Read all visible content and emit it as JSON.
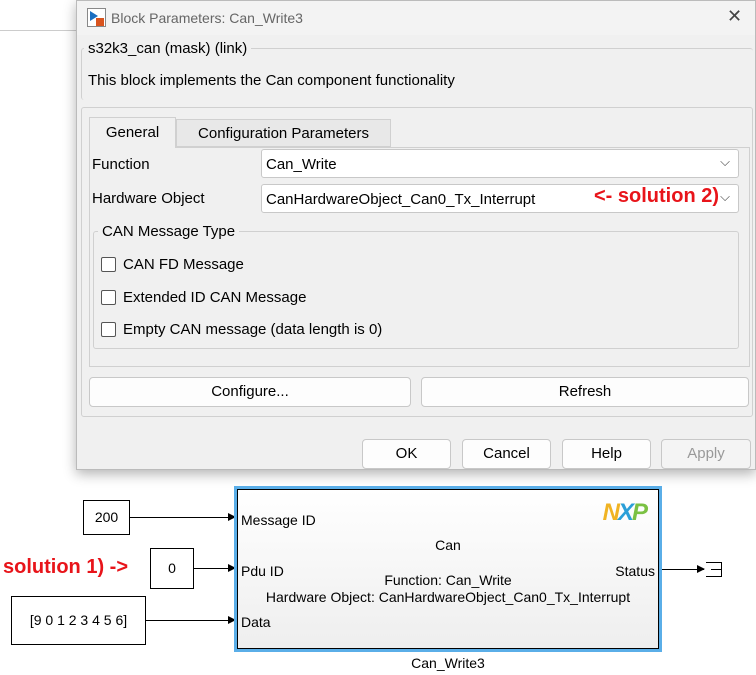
{
  "dialog": {
    "title": "Block Parameters: Can_Write3",
    "mask_title": "s32k3_can (mask) (link)",
    "description": "This block implements the Can component functionality",
    "tabs": [
      {
        "label": "General"
      },
      {
        "label": "Configuration Parameters"
      }
    ],
    "function_label": "Function",
    "function_value": "Can_Write",
    "hw_label": "Hardware Object",
    "hw_value": "CanHardwareObject_Can0_Tx_Interrupt",
    "msg_type_group": "CAN Message Type",
    "checkboxes": [
      {
        "label": "CAN FD Message",
        "checked": false
      },
      {
        "label": "Extended ID CAN Message",
        "checked": false
      },
      {
        "label": "Empty CAN message (data length is 0)",
        "checked": false
      }
    ],
    "configure_label": "Configure...",
    "refresh_label": "Refresh",
    "ok_label": "OK",
    "cancel_label": "Cancel",
    "help_label": "Help",
    "apply_label": "Apply"
  },
  "annotations": {
    "solution2": "<- solution 2)",
    "solution1": "solution 1) ->"
  },
  "diagram": {
    "const_msg": "200",
    "const_pdu": "0",
    "const_data": "[9 0 1 2 3 4 5 6]",
    "block": {
      "name": "Can_Write3",
      "title": "Can",
      "logo": "NXP",
      "func_text": "Function: Can_Write",
      "hw_text": "Hardware Object: CanHardwareObject_Can0_Tx_Interrupt",
      "ports_in": [
        "Message ID",
        "Pdu ID",
        "Data"
      ],
      "port_out": "Status"
    }
  }
}
